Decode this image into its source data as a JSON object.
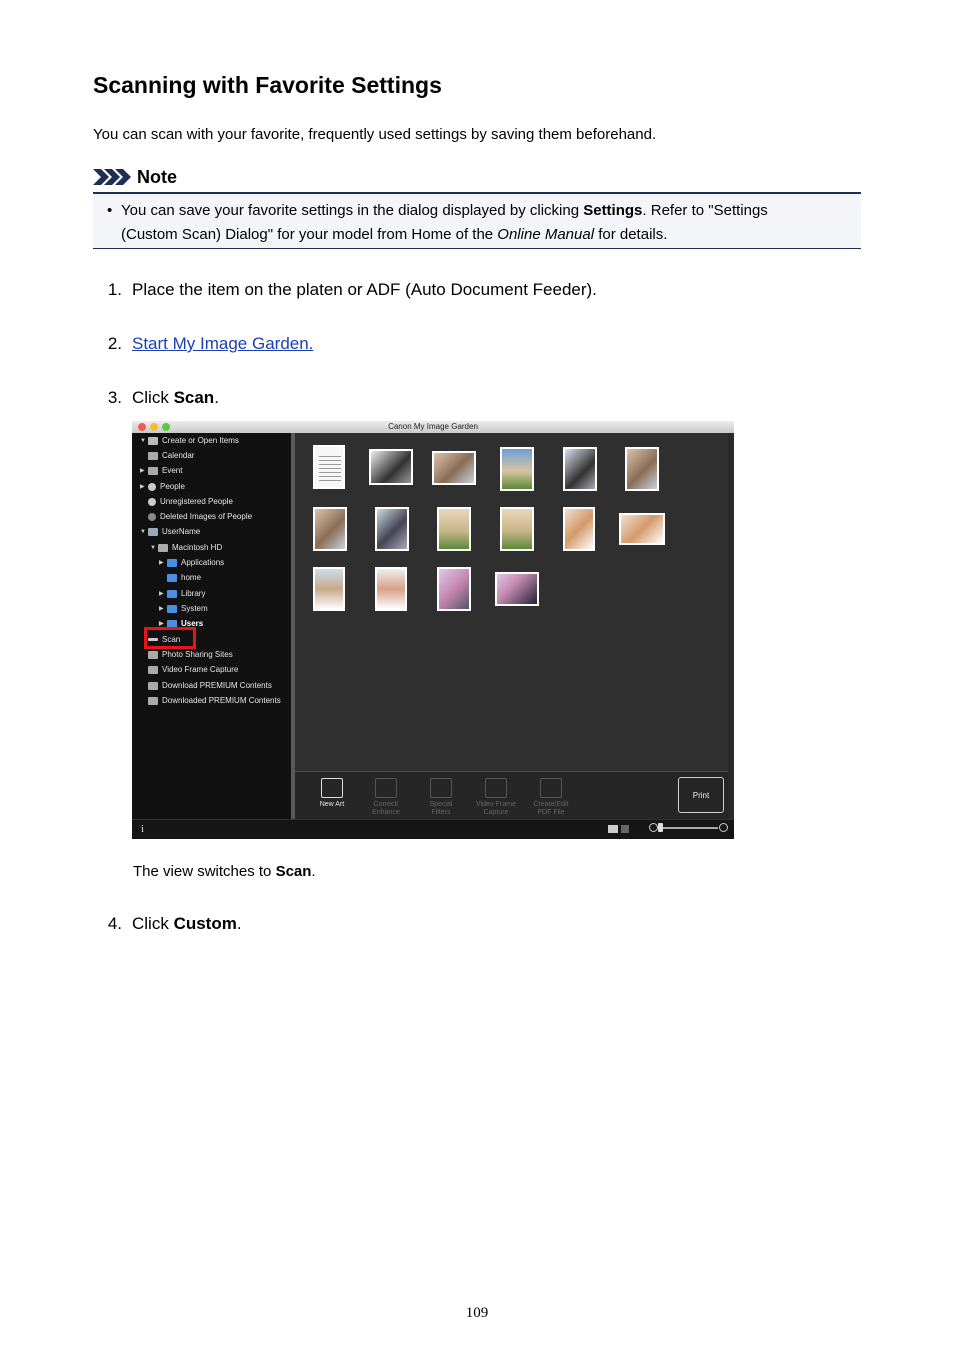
{
  "page": {
    "title": "Scanning with Favorite Settings",
    "intro": "You can scan with your favorite, frequently used settings by saving them beforehand.",
    "note": {
      "label": "Note",
      "bullet": "•",
      "text_1": "You can save your favorite settings in the dialog displayed by clicking ",
      "settings": "Settings",
      "text_2": ". Refer to \"Settings",
      "text_3": "(Custom Scan) Dialog\" for your model from Home of the ",
      "online_manual": "Online Manual",
      "text_4": " for details."
    },
    "steps": [
      {
        "num": "1.",
        "text": "Place the item on the platen or ADF (Auto Document Feeder)."
      },
      {
        "num": "2.",
        "link": "Start My Image Garden."
      },
      {
        "num": "3.",
        "pre": "Click ",
        "bold": "Scan",
        "post": "."
      },
      {
        "num": "4.",
        "pre": "Click ",
        "bold": "Custom",
        "post": "."
      }
    ],
    "caption": {
      "pre": "The view switches to ",
      "bold": "Scan",
      "post": "."
    },
    "page_number": "109"
  },
  "app": {
    "window_title": "Canon My Image Garden",
    "sidebar": [
      {
        "label": "Create or Open Items",
        "arrow": "▼"
      },
      {
        "label": "Calendar",
        "arrow": ""
      },
      {
        "label": "Event",
        "arrow": "▶"
      },
      {
        "label": "People",
        "arrow": "▶"
      },
      {
        "label": "Unregistered People",
        "arrow": ""
      },
      {
        "label": "Deleted Images of People",
        "arrow": ""
      },
      {
        "label": "UserName",
        "arrow": "▼"
      },
      {
        "label": "Macintosh HD",
        "arrow": "▼"
      },
      {
        "label": "Applications",
        "arrow": "▶"
      },
      {
        "label": "home",
        "arrow": ""
      },
      {
        "label": "Library",
        "arrow": "▶"
      },
      {
        "label": "System",
        "arrow": "▶"
      },
      {
        "label": "Users",
        "arrow": "▶"
      },
      {
        "label": "Scan",
        "arrow": ""
      },
      {
        "label": "Photo Sharing Sites",
        "arrow": ""
      },
      {
        "label": "Video Frame Capture",
        "arrow": ""
      },
      {
        "label": "Download PREMIUM Contents",
        "arrow": ""
      },
      {
        "label": "Downloaded PREMIUM Contents",
        "arrow": ""
      }
    ],
    "toolbar": [
      {
        "label_1": "New Art",
        "label_2": ""
      },
      {
        "label_1": "Correct/",
        "label_2": "Enhance"
      },
      {
        "label_1": "Special",
        "label_2": "Filters"
      },
      {
        "label_1": "Video Frame",
        "label_2": "Capture"
      },
      {
        "label_1": "Create/Edit",
        "label_2": "PDF File"
      }
    ],
    "print_label": "Print",
    "info_label": "i",
    "colors": {
      "highlight": "#e2161c",
      "link": "#1a3fb5",
      "note_border": "#1f2f57"
    }
  }
}
